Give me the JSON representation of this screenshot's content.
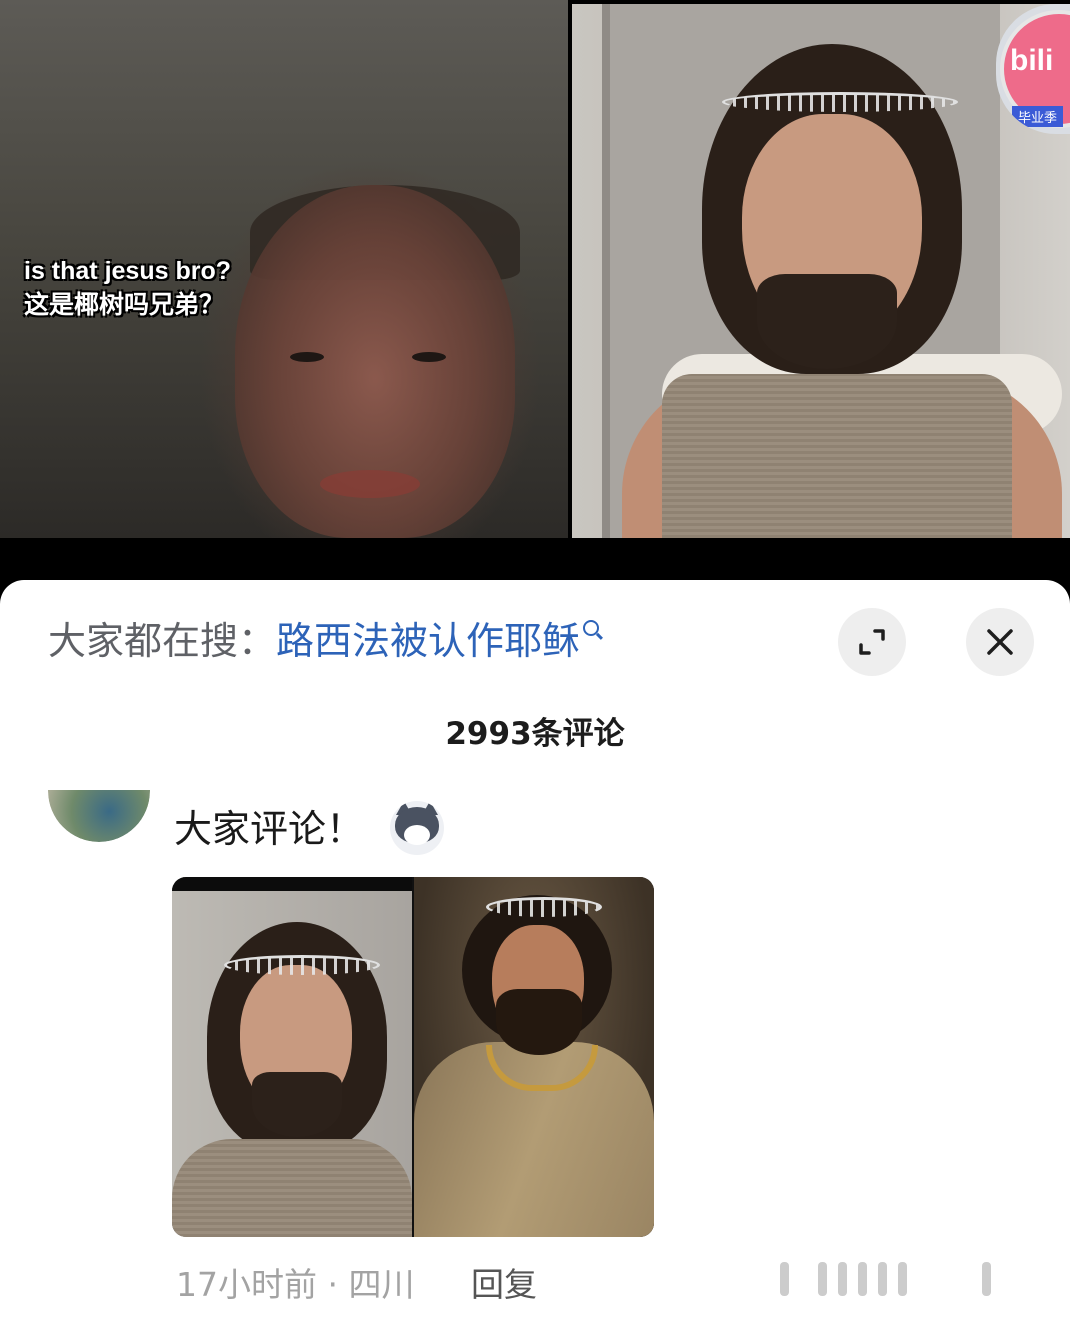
{
  "video": {
    "subtitle_en": "is that jesus bro?",
    "subtitle_zh": "这是椰树吗兄弟？",
    "badge_logo": "bili",
    "badge_sub": "毕业季"
  },
  "sheet": {
    "search_label": "大家都在搜：",
    "search_query": "路西法被认作耶稣",
    "search_icon": "search-icon",
    "expand_icon": "expand-icon",
    "close_icon": "close-icon",
    "comment_count": "2993条评论"
  },
  "comment": {
    "text": "大家评论！",
    "emoji": "husky-dog-face",
    "time": "17小时前",
    "separator": "·",
    "location": "四川",
    "reply_label": "回复"
  }
}
